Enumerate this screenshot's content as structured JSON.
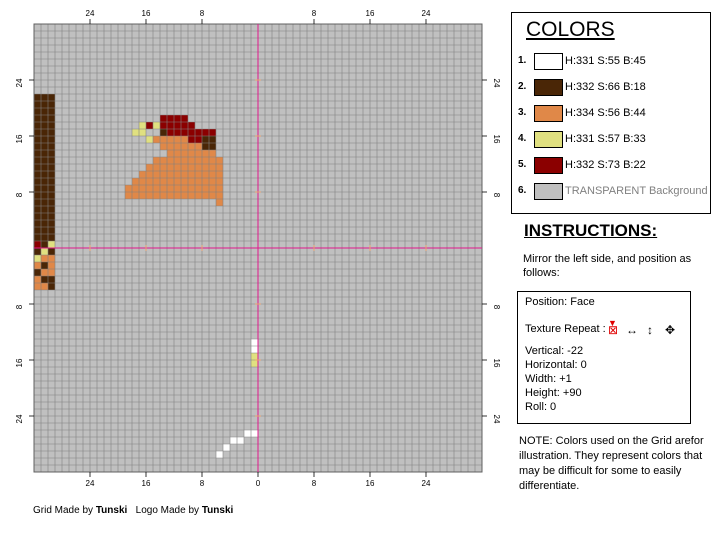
{
  "grid": {
    "top_ticks": [
      "24",
      "16",
      "8",
      "8",
      "16",
      "24"
    ],
    "bottom_ticks": [
      "24",
      "16",
      "8",
      "0",
      "8",
      "16",
      "24"
    ],
    "left_ticks": [
      "24",
      "16",
      "8",
      "8",
      "16",
      "24"
    ],
    "right_ticks": [
      "24",
      "16",
      "8",
      "8",
      "16",
      "24"
    ],
    "background_color": "#c0c0c0",
    "line_color": "#808080",
    "axis_color": "#e0188c"
  },
  "colors": {
    "title": "COLORS",
    "items": [
      {
        "num": "1.",
        "label": "H:331 S:55 B:45",
        "swatch": "#ffffff",
        "muted": false
      },
      {
        "num": "2.",
        "label": "H:332 S:66 B:18",
        "swatch": "#4a2606",
        "muted": false
      },
      {
        "num": "3.",
        "label": "H:334 S:56 B:44",
        "swatch": "#e08848",
        "muted": false
      },
      {
        "num": "4.",
        "label": "H:331 S:57 B:33",
        "swatch": "#e0e080",
        "muted": false
      },
      {
        "num": "5.",
        "label": "H:332 S:73 B:22",
        "swatch": "#8b0000",
        "muted": false
      },
      {
        "num": "6.",
        "label": "TRANSPARENT Background",
        "swatch": "#c0c0c0",
        "muted": true
      }
    ]
  },
  "instructions": {
    "title": "INSTRUCTIONS:",
    "text": "Mirror the left side, and position as follows:"
  },
  "position_panel": {
    "position": "Position: Face",
    "texture_repeat": "Texture Repeat :",
    "vertical": "Vertical: -22",
    "horizontal": "Horizontal: 0",
    "width": "Width: +1",
    "height": "Height: +90",
    "roll": "Roll: 0"
  },
  "note": "NOTE: Colors used on the Grid arefor illustration. They represent colors that may be difficult for some to easily differentiate.",
  "footer": {
    "grid_made_by": "Grid Made by",
    "grid_author": "Tunski",
    "logo_made_by": "Logo Made by",
    "logo_author": "Tunski"
  }
}
